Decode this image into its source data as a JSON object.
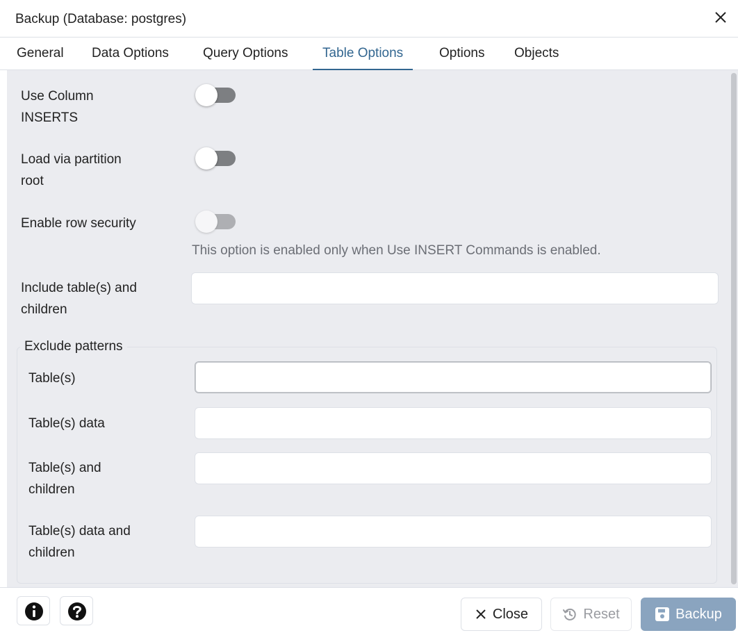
{
  "dialog": {
    "title": "Backup (Database: postgres)"
  },
  "tabs": [
    {
      "label": "General"
    },
    {
      "label": "Data Options"
    },
    {
      "label": "Query Options"
    },
    {
      "label": "Table Options",
      "active": true
    },
    {
      "label": "Options"
    },
    {
      "label": "Objects"
    }
  ],
  "options": {
    "use_column_inserts": {
      "label_line1": "Use Column",
      "label_line2": "INSERTS",
      "enabled": false
    },
    "load_via_partition_root": {
      "label_line1": "Load via partition",
      "label_line2": "root",
      "enabled": false
    },
    "enable_row_security": {
      "label": "Enable row security",
      "enabled": false,
      "disabled": true,
      "hint": "This option is enabled only when Use INSERT Commands is enabled."
    },
    "include_tables_children": {
      "label_line1": "Include table(s) and",
      "label_line2": "children",
      "value": ""
    }
  },
  "exclude": {
    "legend": "Exclude patterns",
    "tables": {
      "label": "Table(s)",
      "value": ""
    },
    "tables_data": {
      "label": "Table(s) data",
      "value": ""
    },
    "tables_children": {
      "label_line1": "Table(s) and",
      "label_line2": "children",
      "value": ""
    },
    "tables_data_children": {
      "label_line1": "Table(s) data and",
      "label_line2": "children",
      "value": ""
    }
  },
  "footer": {
    "info_icon": "info-circle-icon",
    "help_icon": "question-circle-icon",
    "close_label": "Close",
    "reset_label": "Reset",
    "backup_label": "Backup"
  },
  "colors": {
    "accent": "#326690",
    "panel_bg": "#ebecf0",
    "primary_button": "#8aa4bf",
    "switch_off": "#7d7f82"
  }
}
